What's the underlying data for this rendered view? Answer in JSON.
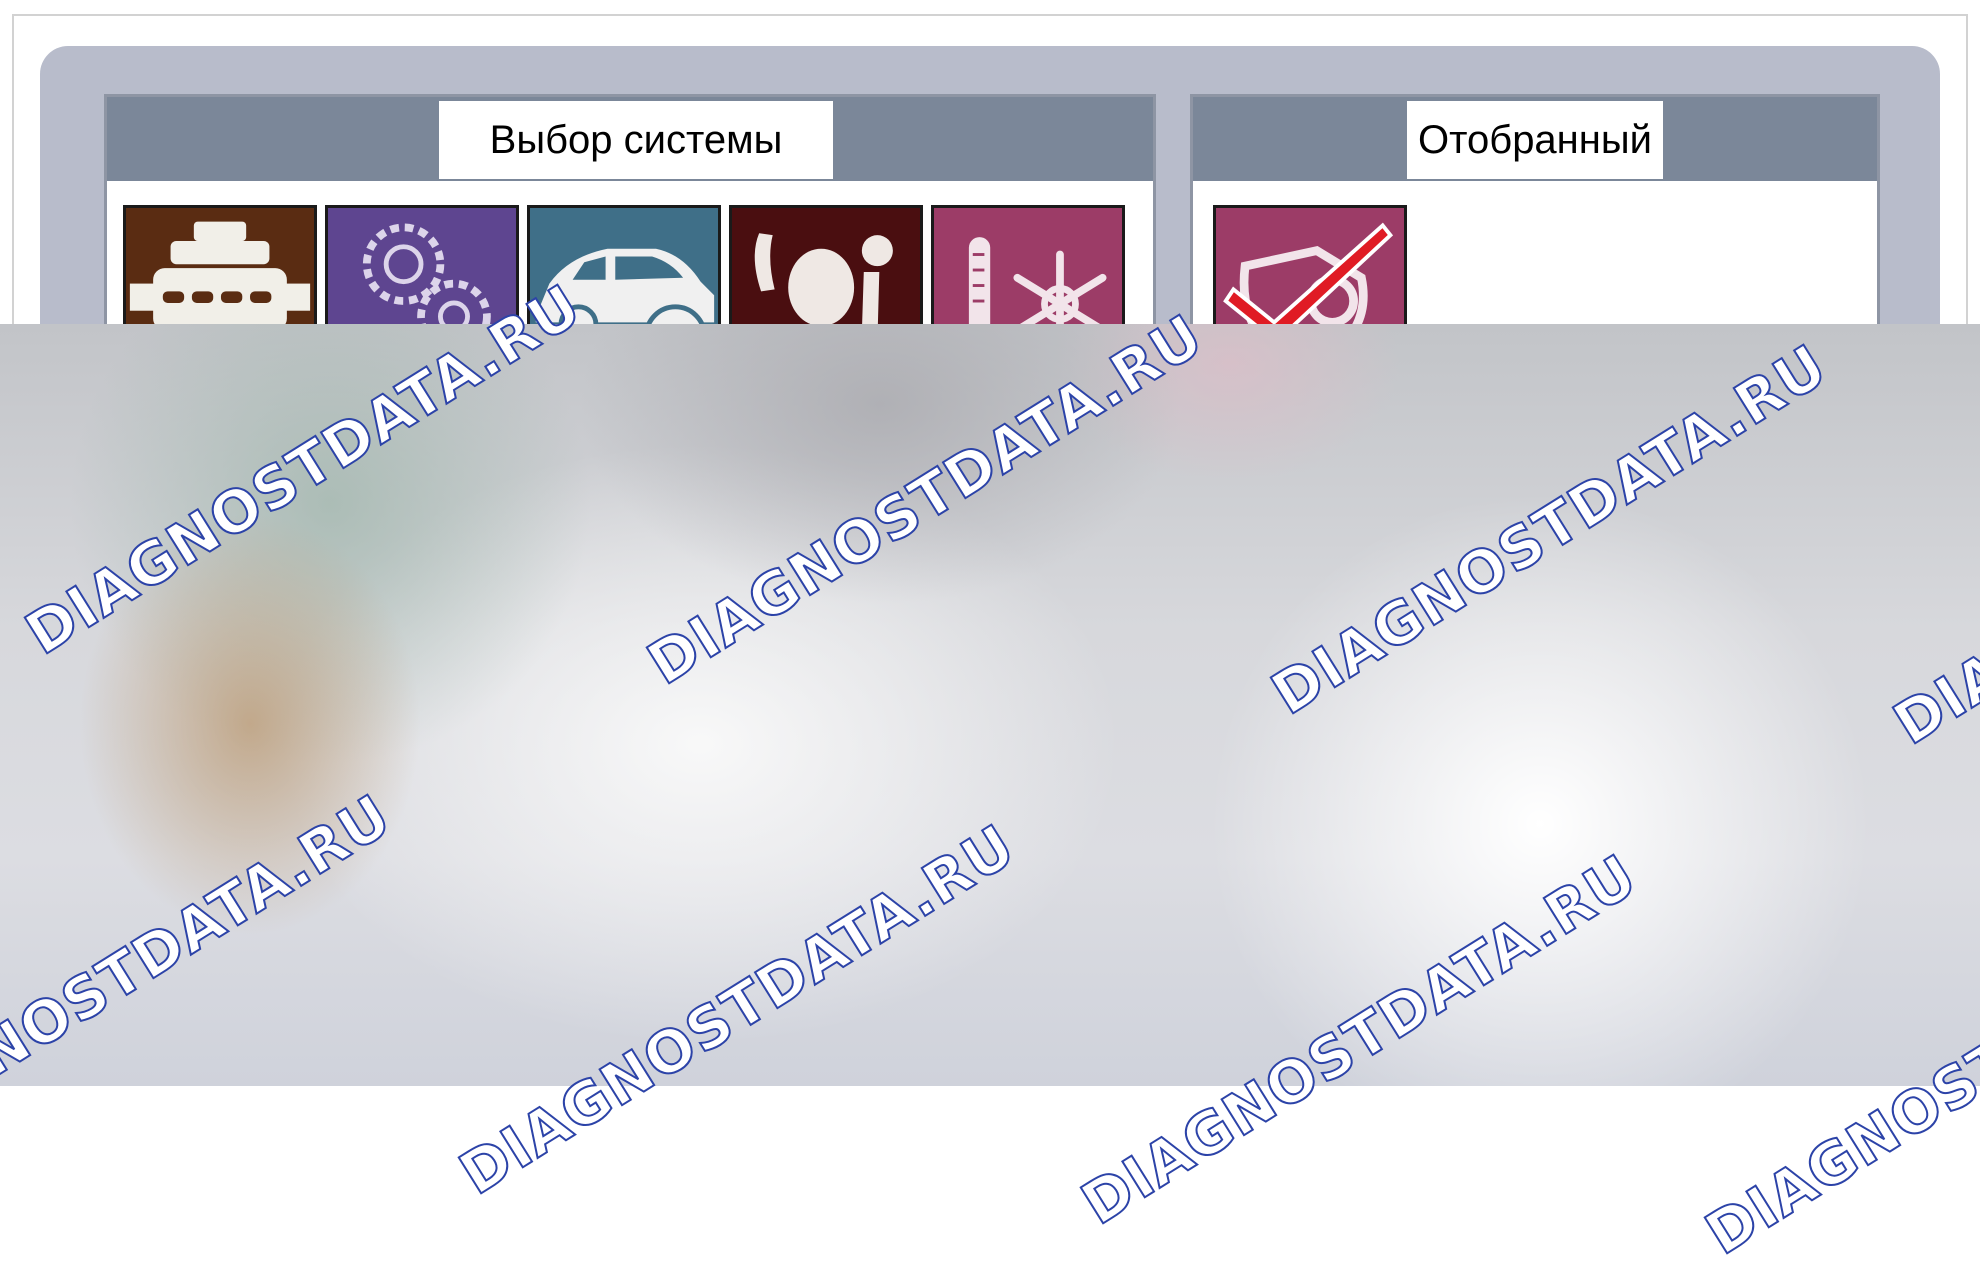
{
  "panels": {
    "system_select": {
      "title": "Выбор системы",
      "tiles": [
        {
          "icon": "engine-icon",
          "bg": "#5a2c12"
        },
        {
          "icon": "gears-transmission-icon",
          "bg": "#5e4590"
        },
        {
          "icon": "car-brake-icon",
          "bg": "#3f6f88"
        },
        {
          "icon": "airbag-seat-icon",
          "bg": "#4a0e10"
        },
        {
          "icon": "climate-thermometer-snowflake-icon",
          "bg": "#9c3c67"
        }
      ]
    },
    "selected": {
      "title": "Отобранный",
      "tiles": [
        {
          "icon": "selected-checkmark-icon",
          "bg": "#9c3c67"
        }
      ]
    }
  },
  "watermark": {
    "text": "DIAGNOSTDATA.RU",
    "color": "#2c43a8"
  }
}
